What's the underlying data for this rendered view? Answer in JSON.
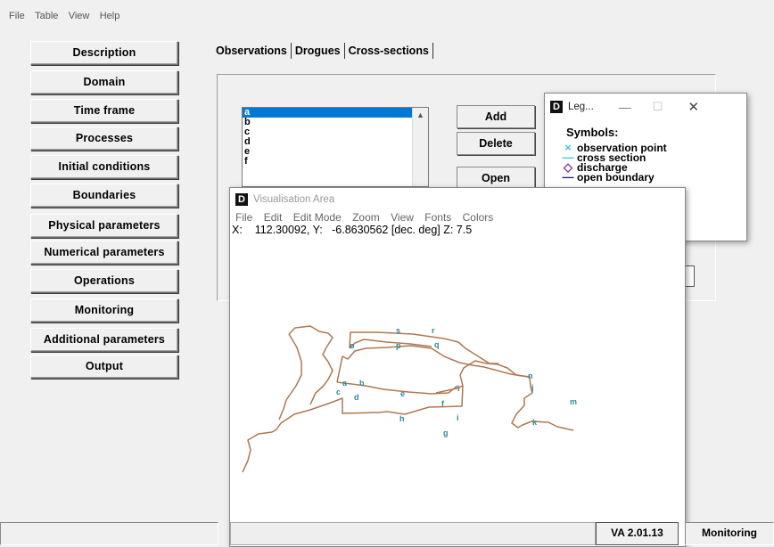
{
  "menu": [
    "File",
    "Table",
    "View",
    "Help"
  ],
  "nav": [
    "Description",
    "Domain",
    "Time frame",
    "Processes",
    "Initial conditions",
    "Boundaries",
    "Physical parameters",
    "Numerical parameters",
    "Operations",
    "Monitoring",
    "Additional parameters",
    "Output"
  ],
  "tabs": [
    "Observations",
    "Drogues",
    "Cross-sections"
  ],
  "list_items": [
    "a",
    "b",
    "c",
    "d",
    "e",
    "f"
  ],
  "buttons": {
    "add": "Add",
    "delete": "Delete",
    "open": "Open"
  },
  "legend": {
    "title": "Leg...",
    "heading": "Symbols:",
    "items": [
      {
        "symbol": "×",
        "label": "observation point",
        "color": "#38c8d8"
      },
      {
        "symbol": "—",
        "label": "cross section",
        "color": "#38c8d8"
      },
      {
        "symbol": "◇",
        "label": "discharge",
        "color": "#7a1f9a"
      },
      {
        "symbol": "—",
        "label": "open boundary",
        "color": "#1a1a6a"
      }
    ]
  },
  "vis": {
    "title": "Visualisation Area",
    "menu": [
      "File",
      "Edit",
      "Edit Mode",
      "Zoom",
      "View",
      "Fonts",
      "Colors"
    ],
    "coords": "X:    112.30092, Y:   -6.8630562 [dec. deg] Z: 7.5"
  },
  "obs_points": [
    "a",
    "b",
    "c",
    "d",
    "e",
    "f",
    "g",
    "h",
    "i",
    "j",
    "k",
    "m",
    "n",
    "o",
    "p",
    "q",
    "r",
    "s"
  ],
  "status": {
    "version": "VA 2.01.13",
    "mode": "Monitoring"
  },
  "colors": {
    "coastline": "#b07850",
    "points": "#38c8d8",
    "selection": "#0078d7"
  }
}
